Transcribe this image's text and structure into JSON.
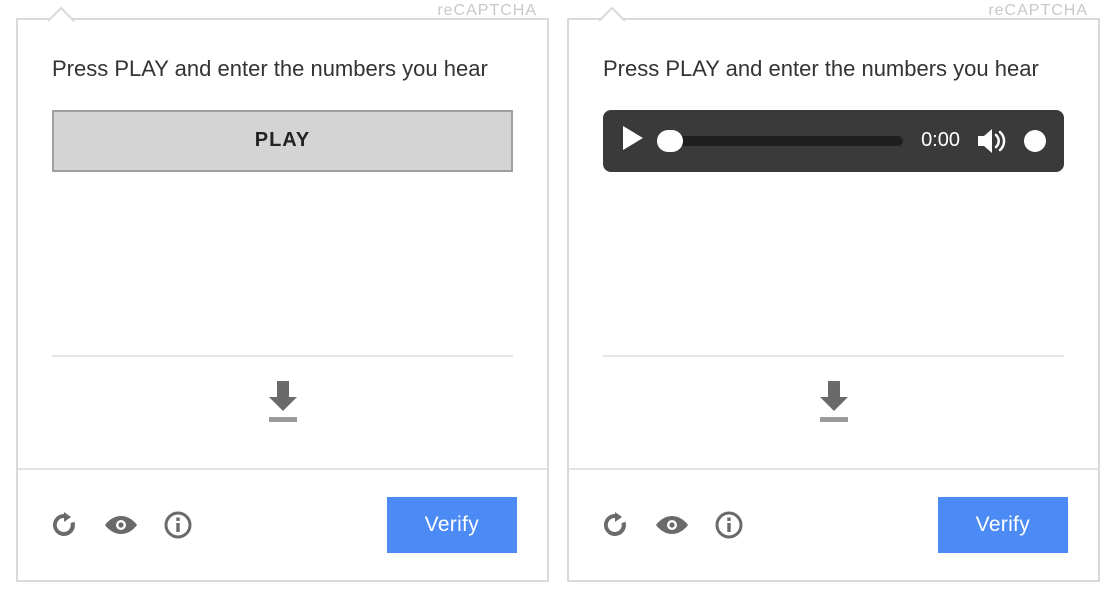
{
  "brand_text": "reCAPTCHA",
  "left": {
    "instruction": "Press PLAY and enter the numbers you hear",
    "play_label": "PLAY",
    "verify_label": "Verify"
  },
  "right": {
    "instruction": "Press PLAY and enter the numbers you hear",
    "player_time": "0:00",
    "verify_label": "Verify"
  },
  "colors": {
    "accent": "#4c8bf5",
    "play_button": "#d4d4d4",
    "player_bg": "#3a3a3a"
  }
}
